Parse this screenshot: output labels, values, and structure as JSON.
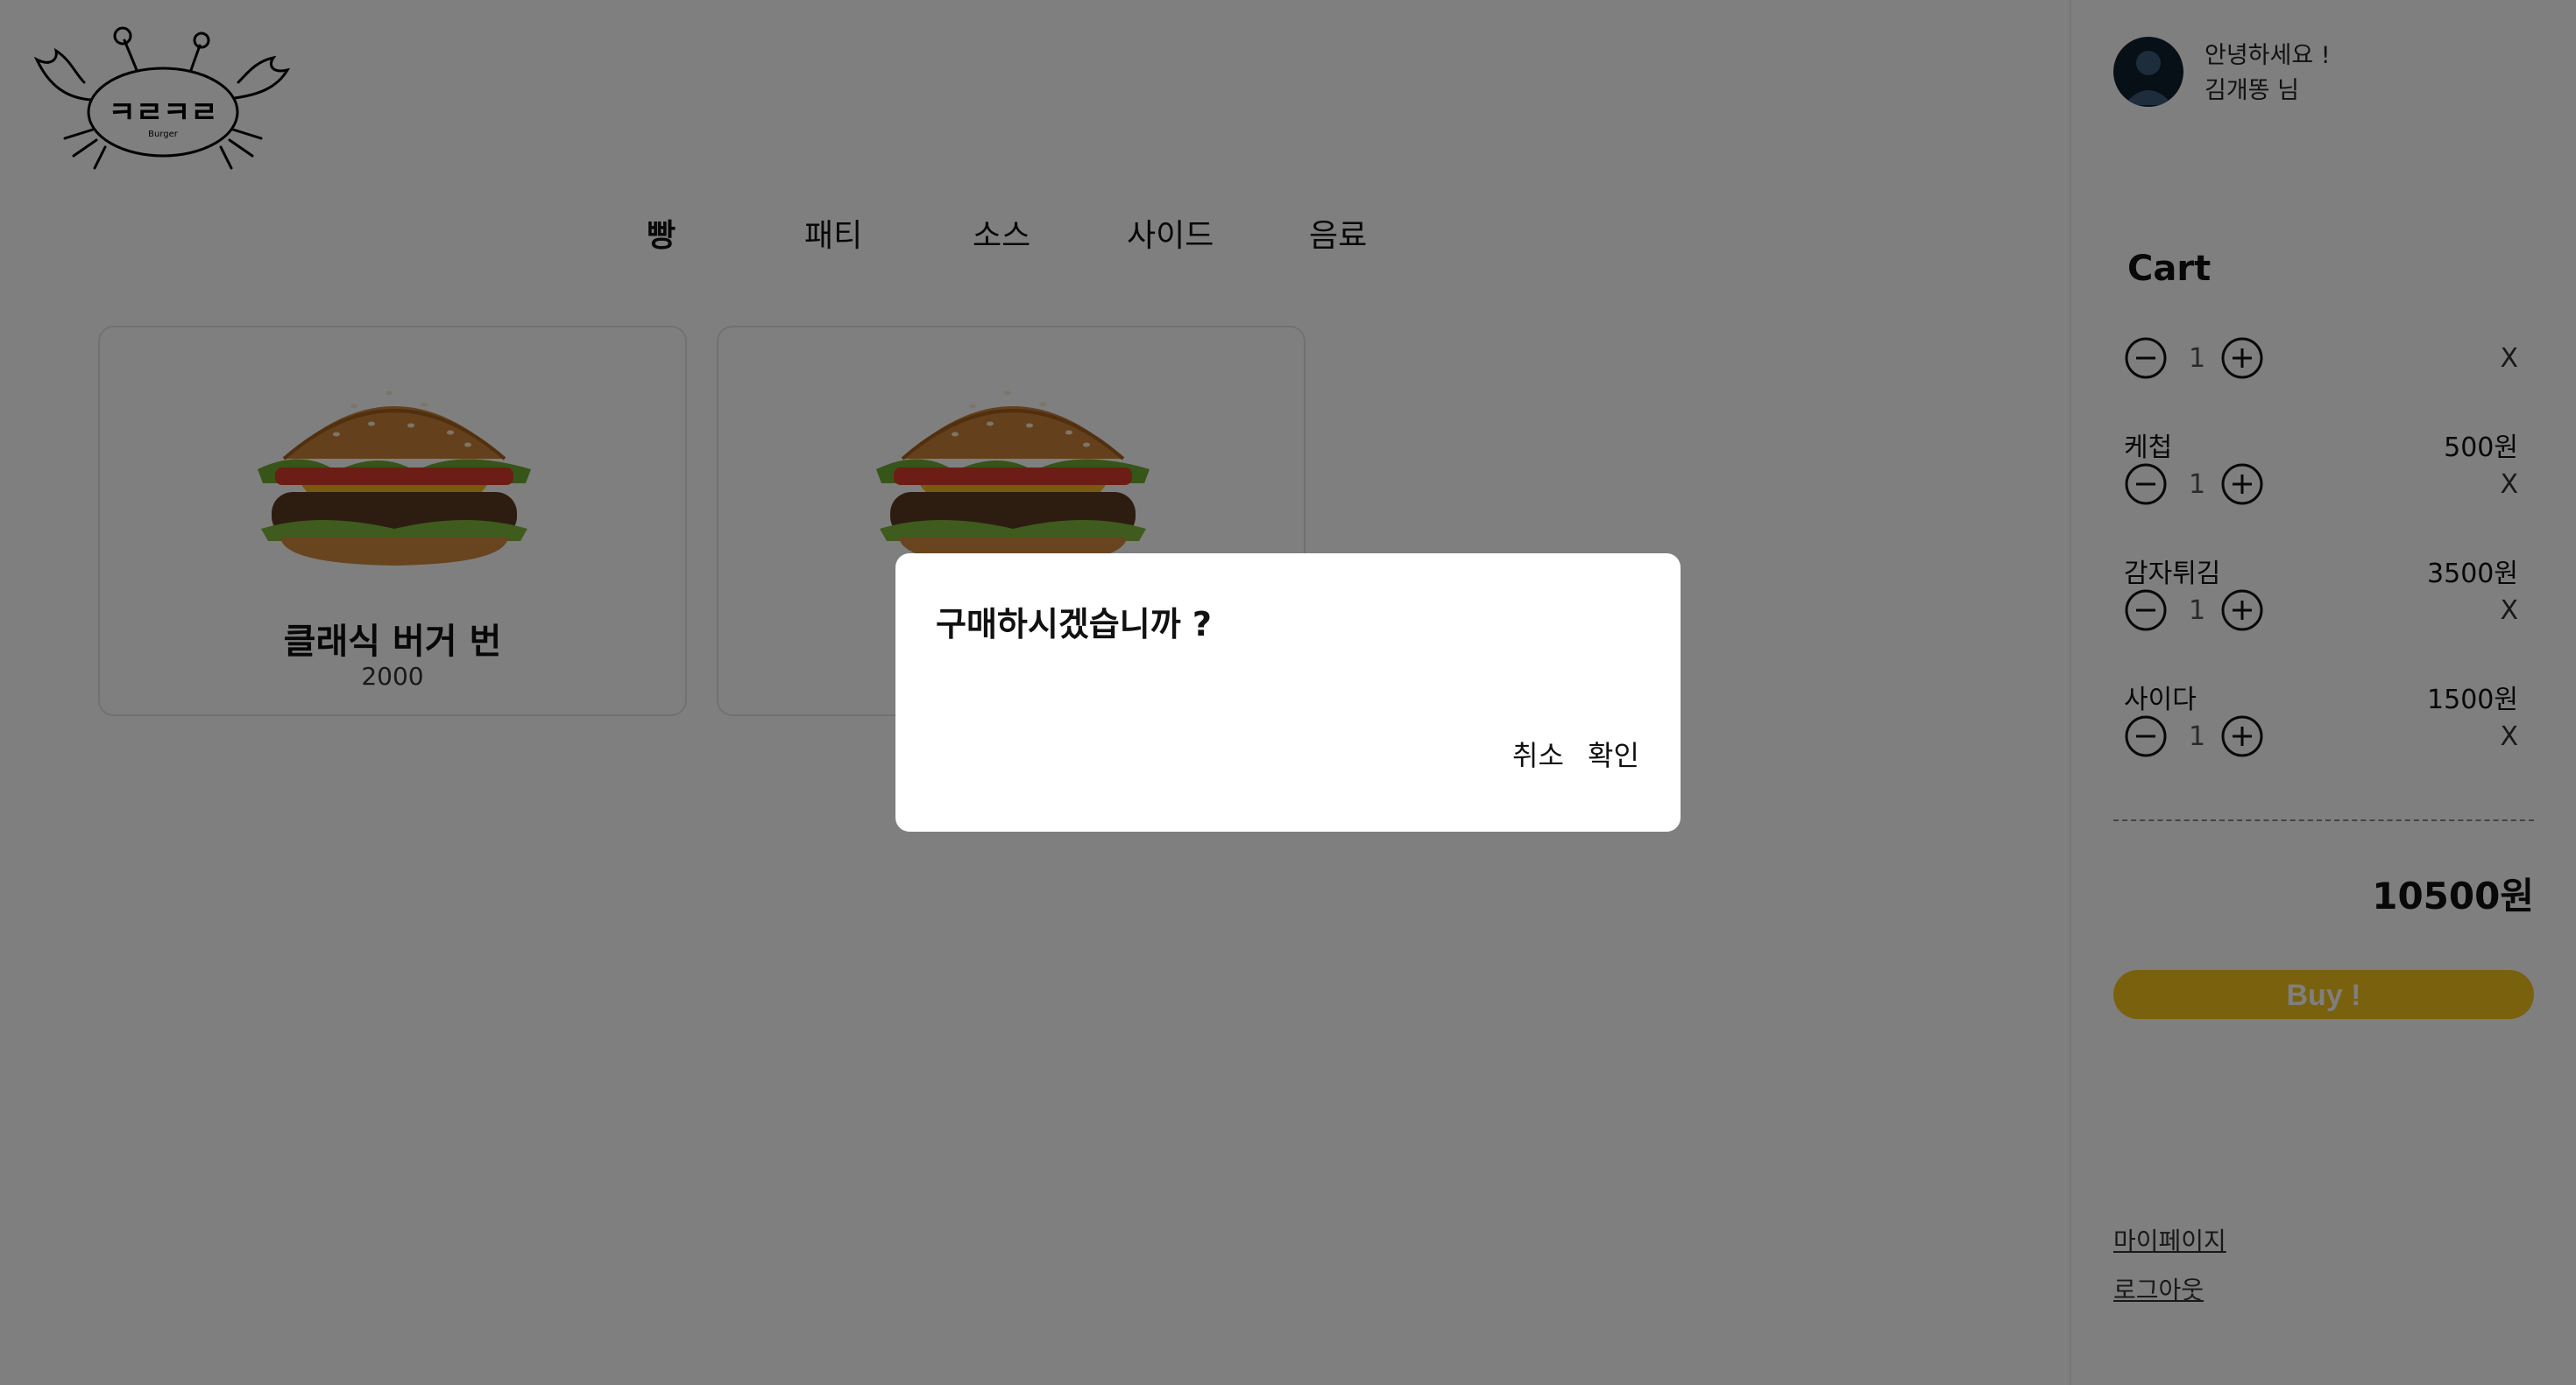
{
  "header": {
    "logo_text": "ㅋㄹㅋㄹ",
    "logo_subtext": "Burger"
  },
  "nav": {
    "items": [
      "빵",
      "패티",
      "소스",
      "사이드",
      "음료"
    ],
    "active": "빵"
  },
  "products": [
    {
      "name": "클래식 버거 번",
      "price": "2000"
    },
    {
      "name": "",
      "price": ""
    }
  ],
  "user": {
    "greeting": "안녕하세요 !",
    "name": "김개똥 님"
  },
  "cart": {
    "title": "Cart",
    "items": [
      {
        "name": "",
        "price": "",
        "qty": "1"
      },
      {
        "name": "케첩",
        "price": "500원",
        "qty": "1"
      },
      {
        "name": "감자튀김",
        "price": "3500원",
        "qty": "1"
      },
      {
        "name": "사이다",
        "price": "1500원",
        "qty": "1"
      }
    ],
    "remove_label": "X",
    "total": "10500원",
    "buy_label": "Buy !"
  },
  "links": {
    "mypage": "마이페이지",
    "logout": "로그아웃"
  },
  "modal": {
    "title": "구매하시겠습니까 ?",
    "cancel_label": "취소",
    "confirm_label": "확인"
  },
  "colors": {
    "accent": "#f5c21a",
    "overlay": "rgba(0,0,0,0.5)"
  }
}
